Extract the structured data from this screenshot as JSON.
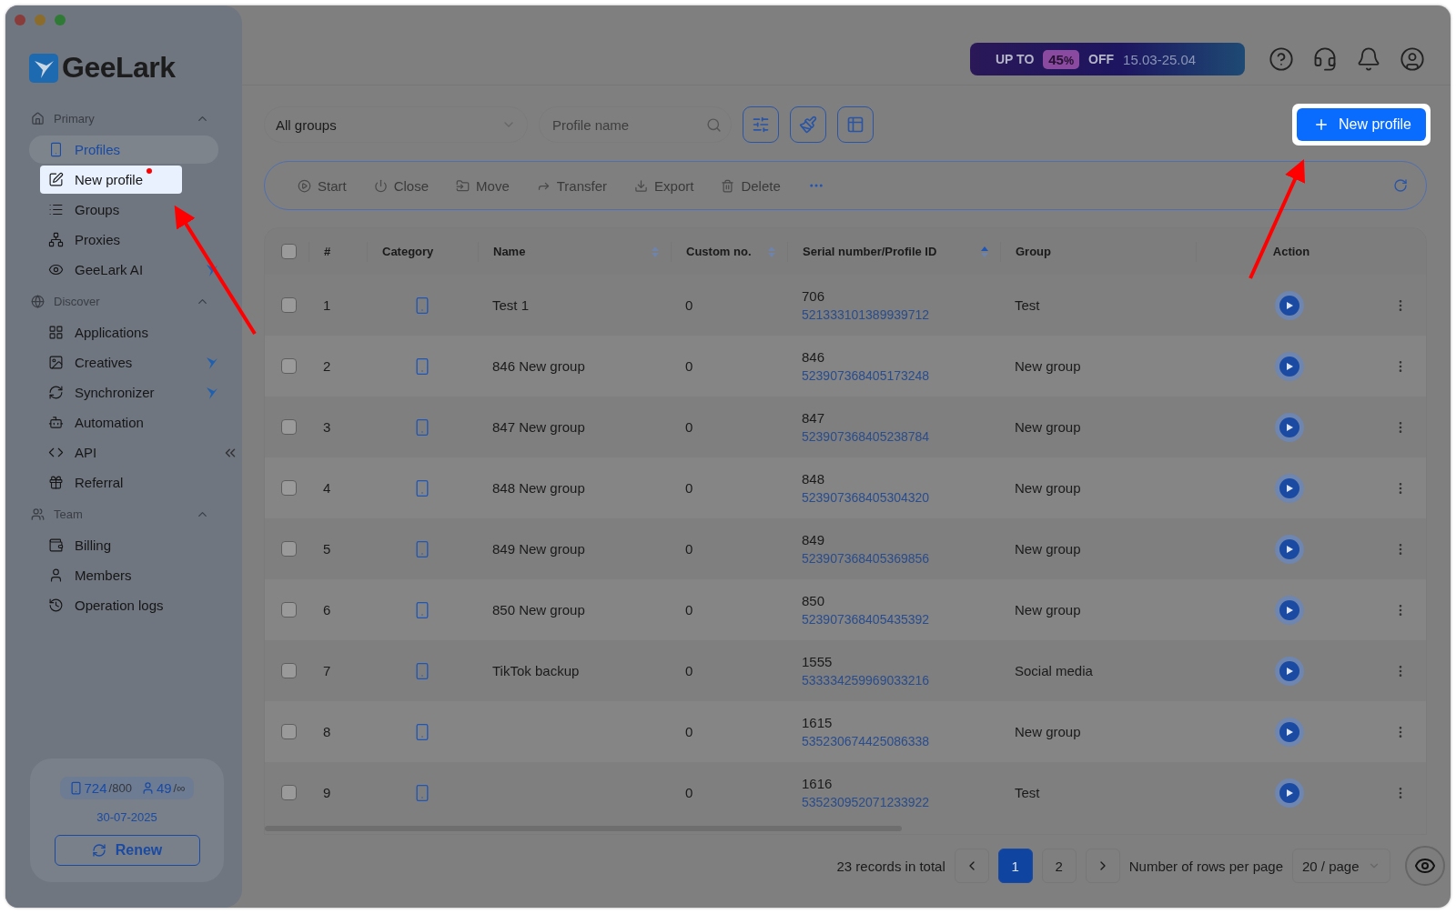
{
  "logo": "GeeLark",
  "sidebar": {
    "sections": [
      {
        "title": "Primary",
        "expanded": true,
        "items": [
          {
            "label": "Profiles",
            "selected": true,
            "highlighted": false,
            "dot": false,
            "badge": false
          },
          {
            "label": "New profile",
            "selected": false,
            "highlighted": true,
            "dot": true,
            "badge": false
          },
          {
            "label": "Groups",
            "selected": false,
            "highlighted": false,
            "dot": false,
            "badge": false
          },
          {
            "label": "Proxies",
            "selected": false,
            "highlighted": false,
            "dot": false,
            "badge": false
          },
          {
            "label": "GeeLark AI",
            "selected": false,
            "highlighted": false,
            "dot": false,
            "badge": true
          }
        ]
      },
      {
        "title": "Discover",
        "expanded": true,
        "items": [
          {
            "label": "Applications",
            "selected": false,
            "highlighted": false,
            "dot": false,
            "badge": false
          },
          {
            "label": "Creatives",
            "selected": false,
            "highlighted": false,
            "dot": false,
            "badge": true
          },
          {
            "label": "Synchronizer",
            "selected": false,
            "highlighted": false,
            "dot": false,
            "badge": true
          },
          {
            "label": "Automation",
            "selected": false,
            "highlighted": false,
            "dot": false,
            "badge": false
          },
          {
            "label": "API",
            "selected": false,
            "highlighted": false,
            "dot": false,
            "badge": false
          },
          {
            "label": "Referral",
            "selected": false,
            "highlighted": false,
            "dot": false,
            "badge": false
          }
        ]
      },
      {
        "title": "Team",
        "expanded": true,
        "items": [
          {
            "label": "Billing",
            "selected": false,
            "highlighted": false,
            "dot": false,
            "badge": false
          },
          {
            "label": "Members",
            "selected": false,
            "highlighted": false,
            "dot": false,
            "badge": false
          },
          {
            "label": "Operation logs",
            "selected": false,
            "highlighted": false,
            "dot": false,
            "badge": false
          }
        ]
      }
    ],
    "usage": {
      "profiles_used": "724",
      "profiles_total": "/800",
      "members_used": "49",
      "members_total": "/∞",
      "expiry": "30-07-2025",
      "renew": "Renew"
    }
  },
  "promo": {
    "prefix": "UP TO",
    "discount": "45",
    "percent": "%",
    "suffix": "OFF",
    "dates": "15.03-25.04"
  },
  "toolbar": {
    "group_select": "All groups",
    "search_placeholder": "Profile name",
    "new_button": "New profile",
    "new_button_highlighted": true
  },
  "actions": [
    {
      "label": "Start",
      "disabled": true
    },
    {
      "label": "Close",
      "disabled": true
    },
    {
      "label": "Move",
      "disabled": true
    },
    {
      "label": "Transfer",
      "disabled": true
    },
    {
      "label": "Export",
      "disabled": true
    },
    {
      "label": "Delete",
      "disabled": true
    }
  ],
  "table": {
    "select_all_checked": false,
    "columns": [
      {
        "label": "#",
        "sortable": false
      },
      {
        "label": "Category",
        "sortable": false
      },
      {
        "label": "Name",
        "sortable": true,
        "sorted": false
      },
      {
        "label": "Custom no.",
        "sortable": true,
        "sorted": false
      },
      {
        "label": "Serial number/Profile ID",
        "sortable": true,
        "sorted": true
      },
      {
        "label": "Group",
        "sortable": false
      },
      {
        "label": "Action",
        "sortable": false
      }
    ],
    "rows": [
      {
        "index": "1",
        "name": "Test 1",
        "custom_no": "0",
        "serial": "706",
        "profile_id": "521333101389939712",
        "group": "Test",
        "checked": false
      },
      {
        "index": "2",
        "name": "846 New group",
        "custom_no": "0",
        "serial": "846",
        "profile_id": "523907368405173248",
        "group": "New group",
        "checked": false
      },
      {
        "index": "3",
        "name": "847 New group",
        "custom_no": "0",
        "serial": "847",
        "profile_id": "523907368405238784",
        "group": "New group",
        "checked": false
      },
      {
        "index": "4",
        "name": "848 New group",
        "custom_no": "0",
        "serial": "848",
        "profile_id": "523907368405304320",
        "group": "New group",
        "checked": false
      },
      {
        "index": "5",
        "name": "849 New group",
        "custom_no": "0",
        "serial": "849",
        "profile_id": "523907368405369856",
        "group": "New group",
        "checked": false
      },
      {
        "index": "6",
        "name": "850 New group",
        "custom_no": "0",
        "serial": "850",
        "profile_id": "523907368405435392",
        "group": "New group",
        "checked": false
      },
      {
        "index": "7",
        "name": "TikTok backup",
        "custom_no": "0",
        "serial": "1555",
        "profile_id": "533334259969033216",
        "group": "Social media",
        "checked": false
      },
      {
        "index": "8",
        "custom_no": "0",
        "serial": "1615",
        "profile_id": "535230674425086338",
        "group": "New group",
        "checked": false
      },
      {
        "index": "9",
        "custom_no": "0",
        "serial": "1616",
        "profile_id": "535230952071233922",
        "group": "Test",
        "checked": false
      }
    ]
  },
  "pagination": {
    "total": "23 records in total",
    "pages": [
      {
        "label": "1",
        "selected": true
      },
      {
        "label": "2",
        "selected": false
      }
    ],
    "rows_label": "Number of rows per page",
    "page_size": "20 / page"
  }
}
